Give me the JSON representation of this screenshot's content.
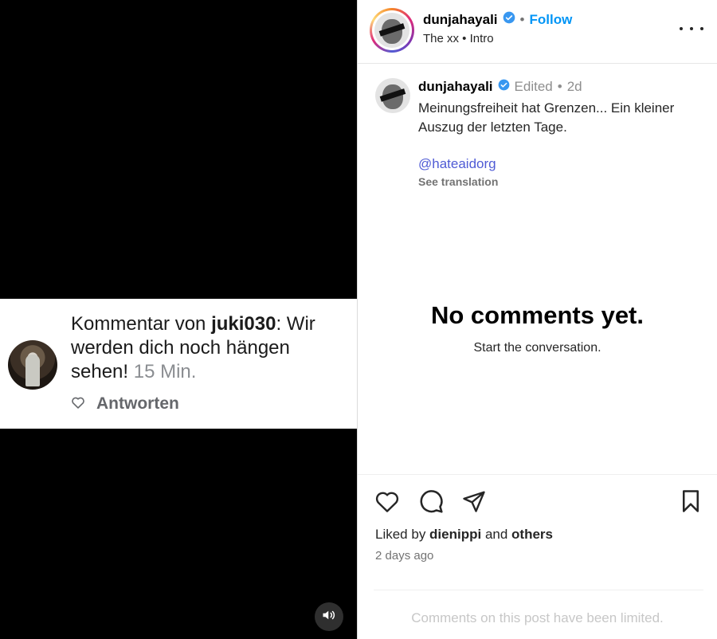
{
  "media": {
    "overlay_comment": {
      "prefix": "Kommentar von ",
      "username": "juki030",
      "text": ": Wir werden dich noch hängen sehen!",
      "time": "15 Min.",
      "reply_label": "Antworten"
    },
    "sound_icon": "speaker-icon"
  },
  "header": {
    "username": "dunjahayali",
    "separator": "•",
    "follow_label": "Follow",
    "audio": "The xx • Intro",
    "verified_color": "#3897f0"
  },
  "caption": {
    "username": "dunjahayali",
    "edited": "Edited",
    "separator": "•",
    "age": "2d",
    "text": "Meinungsfreiheit hat Grenzen... Ein kleiner Auszug der letzten Tage.",
    "mention": "@hateaidorg",
    "translate_label": "See translation"
  },
  "comments": {
    "empty_title": "No comments yet.",
    "empty_sub": "Start the conversation."
  },
  "footer": {
    "liked_prefix": "Liked by ",
    "liked_user": "dienippi",
    "liked_mid": " and ",
    "liked_others": "others",
    "posted": "2 days ago",
    "limited": "Comments on this post have been limited."
  },
  "colors": {
    "accent": "#0095f6",
    "mention": "#4f5bd5",
    "media_bg": "#000000"
  }
}
